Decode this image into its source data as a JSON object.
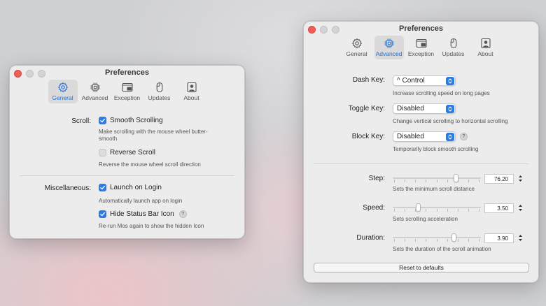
{
  "colors": {
    "accent": "#2a7be4",
    "close": "#ee5f57",
    "window_bg": "#ececec"
  },
  "general_window": {
    "title": "Preferences",
    "tabs": [
      {
        "label": "General",
        "icon": "gear-icon",
        "active": true
      },
      {
        "label": "Advanced",
        "icon": "chip-icon",
        "active": false
      },
      {
        "label": "Exception",
        "icon": "window-icon",
        "active": false
      },
      {
        "label": "Updates",
        "icon": "mouse-icon",
        "active": false
      },
      {
        "label": "About",
        "icon": "person-icon",
        "active": false
      }
    ],
    "scroll_label": "Scroll:",
    "smooth_scrolling": {
      "label": "Smooth Scrolling",
      "checked": true,
      "desc": "Make scrolling with the mouse wheel butter-smooth"
    },
    "reverse_scroll": {
      "label": "Reverse Scroll",
      "checked": false,
      "desc": "Reverse the mouse wheel scroll direction"
    },
    "misc_label": "Miscellaneous:",
    "launch_on_login": {
      "label": "Launch on Login",
      "checked": true,
      "desc": "Automatically launch app on login"
    },
    "hide_status_bar_icon": {
      "label": "Hide Status Bar Icon",
      "checked": true,
      "desc": "Re-run Mos again to show the hidden Icon"
    },
    "help": "?"
  },
  "advanced_window": {
    "title": "Preferences",
    "tabs": [
      {
        "label": "General",
        "icon": "gear-icon",
        "active": false
      },
      {
        "label": "Advanced",
        "icon": "chip-icon",
        "active": true
      },
      {
        "label": "Exception",
        "icon": "window-icon",
        "active": false
      },
      {
        "label": "Updates",
        "icon": "mouse-icon",
        "active": false
      },
      {
        "label": "About",
        "icon": "person-icon",
        "active": false
      }
    ],
    "dash_key": {
      "label": "Dash Key:",
      "value": "^ Control",
      "desc": "Increase scrolling speed on long pages"
    },
    "toggle_key": {
      "label": "Toggle Key:",
      "value": "Disabled",
      "desc": "Change vertical scrolling to horizontal scrolling"
    },
    "block_key": {
      "label": "Block Key:",
      "value": "Disabled",
      "desc": "Temporarily block smooth scrolling"
    },
    "help": "?",
    "step": {
      "label": "Step:",
      "value": "76.20",
      "level": 0.73,
      "desc": "Sets the minimum scroll distance"
    },
    "speed": {
      "label": "Speed:",
      "value": "3.50",
      "level": 0.28,
      "desc": "Sets scrolling acceleration"
    },
    "duration": {
      "label": "Duration:",
      "value": "3.90",
      "level": 0.71,
      "desc": "Sets the duration of the scroll animation"
    },
    "reset_button": "Reset to defaults"
  }
}
